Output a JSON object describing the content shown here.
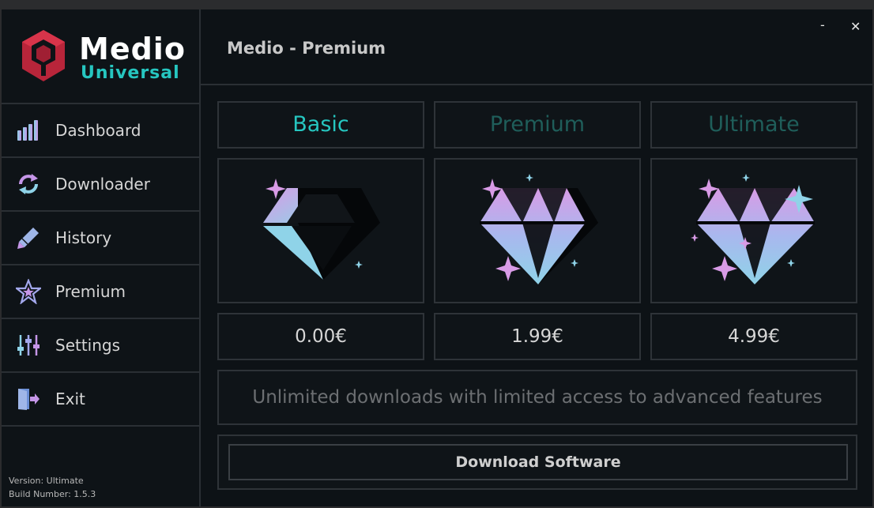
{
  "app": {
    "brand_title": "Medio",
    "brand_subtitle": "Universal",
    "window_controls": {
      "minimize": "-",
      "close": "✕"
    }
  },
  "sidebar": {
    "items": [
      {
        "label": "Dashboard",
        "icon": "bar-chart-icon"
      },
      {
        "label": "Downloader",
        "icon": "sync-icon"
      },
      {
        "label": "History",
        "icon": "pencil-icon"
      },
      {
        "label": "Premium",
        "icon": "star-icon"
      },
      {
        "label": "Settings",
        "icon": "sliders-icon"
      },
      {
        "label": "Exit",
        "icon": "exit-door-icon"
      }
    ],
    "version_text": "Version: Ultimate",
    "build_text": "Build Number: 1.5.3"
  },
  "header": {
    "title": "Medio - Premium"
  },
  "tiers": [
    {
      "name": "Basic",
      "price": "0.00€",
      "selected": true
    },
    {
      "name": "Premium",
      "price": "1.99€",
      "selected": false
    },
    {
      "name": "Ultimate",
      "price": "4.99€",
      "selected": false
    }
  ],
  "description": "Unlimited downloads with limited access to advanced features",
  "download_button": "Download Software",
  "colors": {
    "accent": "#26c6c0",
    "inactive_tier": "#1f5e5a",
    "brand_red": "#c0283a",
    "gem_pink": "#d89be6",
    "gem_blue": "#8fd3e8"
  }
}
